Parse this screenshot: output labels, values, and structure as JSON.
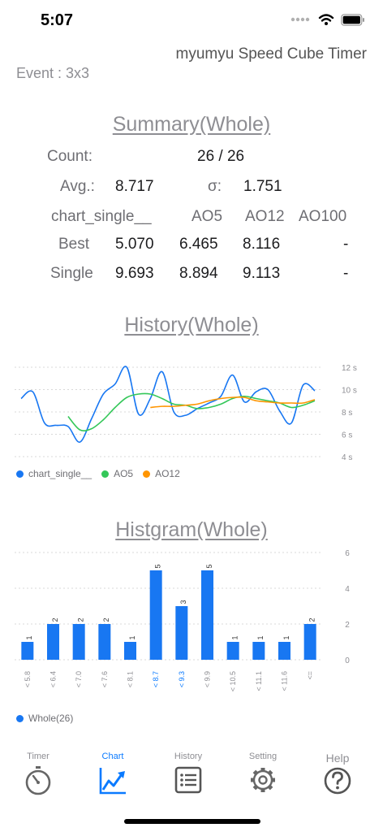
{
  "status": {
    "time": "5:07"
  },
  "app": {
    "title": "myumyu Speed Cube Timer",
    "event": "Event : 3x3"
  },
  "summary": {
    "title": "Summary(Whole)",
    "count_label": "Count:",
    "count_value": "26 / 26",
    "avg_label": "Avg.:",
    "avg_value": "8.717",
    "sigma_label": "σ:",
    "sigma_value": "1.751",
    "headers": [
      "chart_single__",
      "AO5",
      "AO12",
      "AO100"
    ],
    "rows": [
      {
        "label": "Best",
        "values": [
          "5.070",
          "6.465",
          "8.116",
          "-"
        ]
      },
      {
        "label": "Single",
        "values": [
          "9.693",
          "8.894",
          "9.113",
          "-"
        ]
      }
    ]
  },
  "history": {
    "title": "History(Whole)",
    "legend": [
      "chart_single__",
      "AO5",
      "AO12"
    ]
  },
  "histogram": {
    "title": "Histgram(Whole)",
    "legend": "Whole(26)"
  },
  "colors": {
    "single": "#1877f2",
    "ao5": "#34c759",
    "ao12": "#ff9500",
    "accent": "#0a7aff"
  },
  "tabs": [
    {
      "label": "Timer",
      "icon": "stopwatch-icon"
    },
    {
      "label": "Chart",
      "icon": "chart-icon",
      "active": true
    },
    {
      "label": "History",
      "icon": "list-icon"
    },
    {
      "label": "Setting",
      "icon": "gear-icon"
    },
    {
      "label": "Help",
      "icon": "help-icon"
    }
  ],
  "chart_data": [
    {
      "type": "line",
      "yticks": [
        "12 s",
        "10 s",
        "8 s",
        "6 s",
        "4 s"
      ],
      "ylim": [
        4,
        12
      ],
      "grid": true,
      "legend_position": "bottom-left",
      "series": [
        {
          "name": "chart_single__",
          "color": "#1877f2",
          "values": [
            9.2,
            9.8,
            7.0,
            6.8,
            6.7,
            5.3,
            7.4,
            9.6,
            10.5,
            12.0,
            7.8,
            9.2,
            11.6,
            8.0,
            7.7,
            8.3,
            8.8,
            9.4,
            11.3,
            8.9,
            9.8,
            10.0,
            8.1,
            7.0,
            10.4,
            9.9
          ]
        },
        {
          "name": "AO5",
          "color": "#34c759",
          "values": [
            null,
            null,
            null,
            null,
            7.6,
            6.4,
            6.5,
            7.3,
            8.4,
            9.3,
            9.6,
            9.6,
            9.2,
            8.7,
            8.6,
            8.3,
            8.4,
            8.7,
            9.2,
            9.4,
            9.2,
            9.0,
            8.8,
            8.4,
            8.6,
            9.0
          ]
        },
        {
          "name": "AO12",
          "color": "#ff9500",
          "values": [
            null,
            null,
            null,
            null,
            null,
            null,
            null,
            null,
            null,
            null,
            null,
            8.4,
            8.5,
            8.5,
            8.6,
            8.7,
            9.0,
            9.2,
            9.3,
            9.3,
            9.0,
            8.9,
            8.8,
            8.8,
            8.8,
            9.1
          ]
        }
      ]
    },
    {
      "type": "bar",
      "categories": [
        "< 5.8",
        "< 6.4",
        "< 7.0",
        "< 7.6",
        "< 8.1",
        "< 8.7",
        "< 9.3",
        "< 9.9",
        "< 10.5",
        "< 11.1",
        "< 11.6",
        "<="
      ],
      "highlighted": [
        "< 8.7",
        "< 9.3"
      ],
      "series": [
        {
          "name": "Whole(26)",
          "values": [
            1,
            2,
            2,
            2,
            1,
            5,
            3,
            5,
            1,
            1,
            1,
            2
          ]
        }
      ],
      "yticks": [
        "6",
        "4",
        "2",
        "0"
      ],
      "ylim": [
        0,
        6
      ],
      "grid": true,
      "legend_position": "bottom-left"
    }
  ]
}
